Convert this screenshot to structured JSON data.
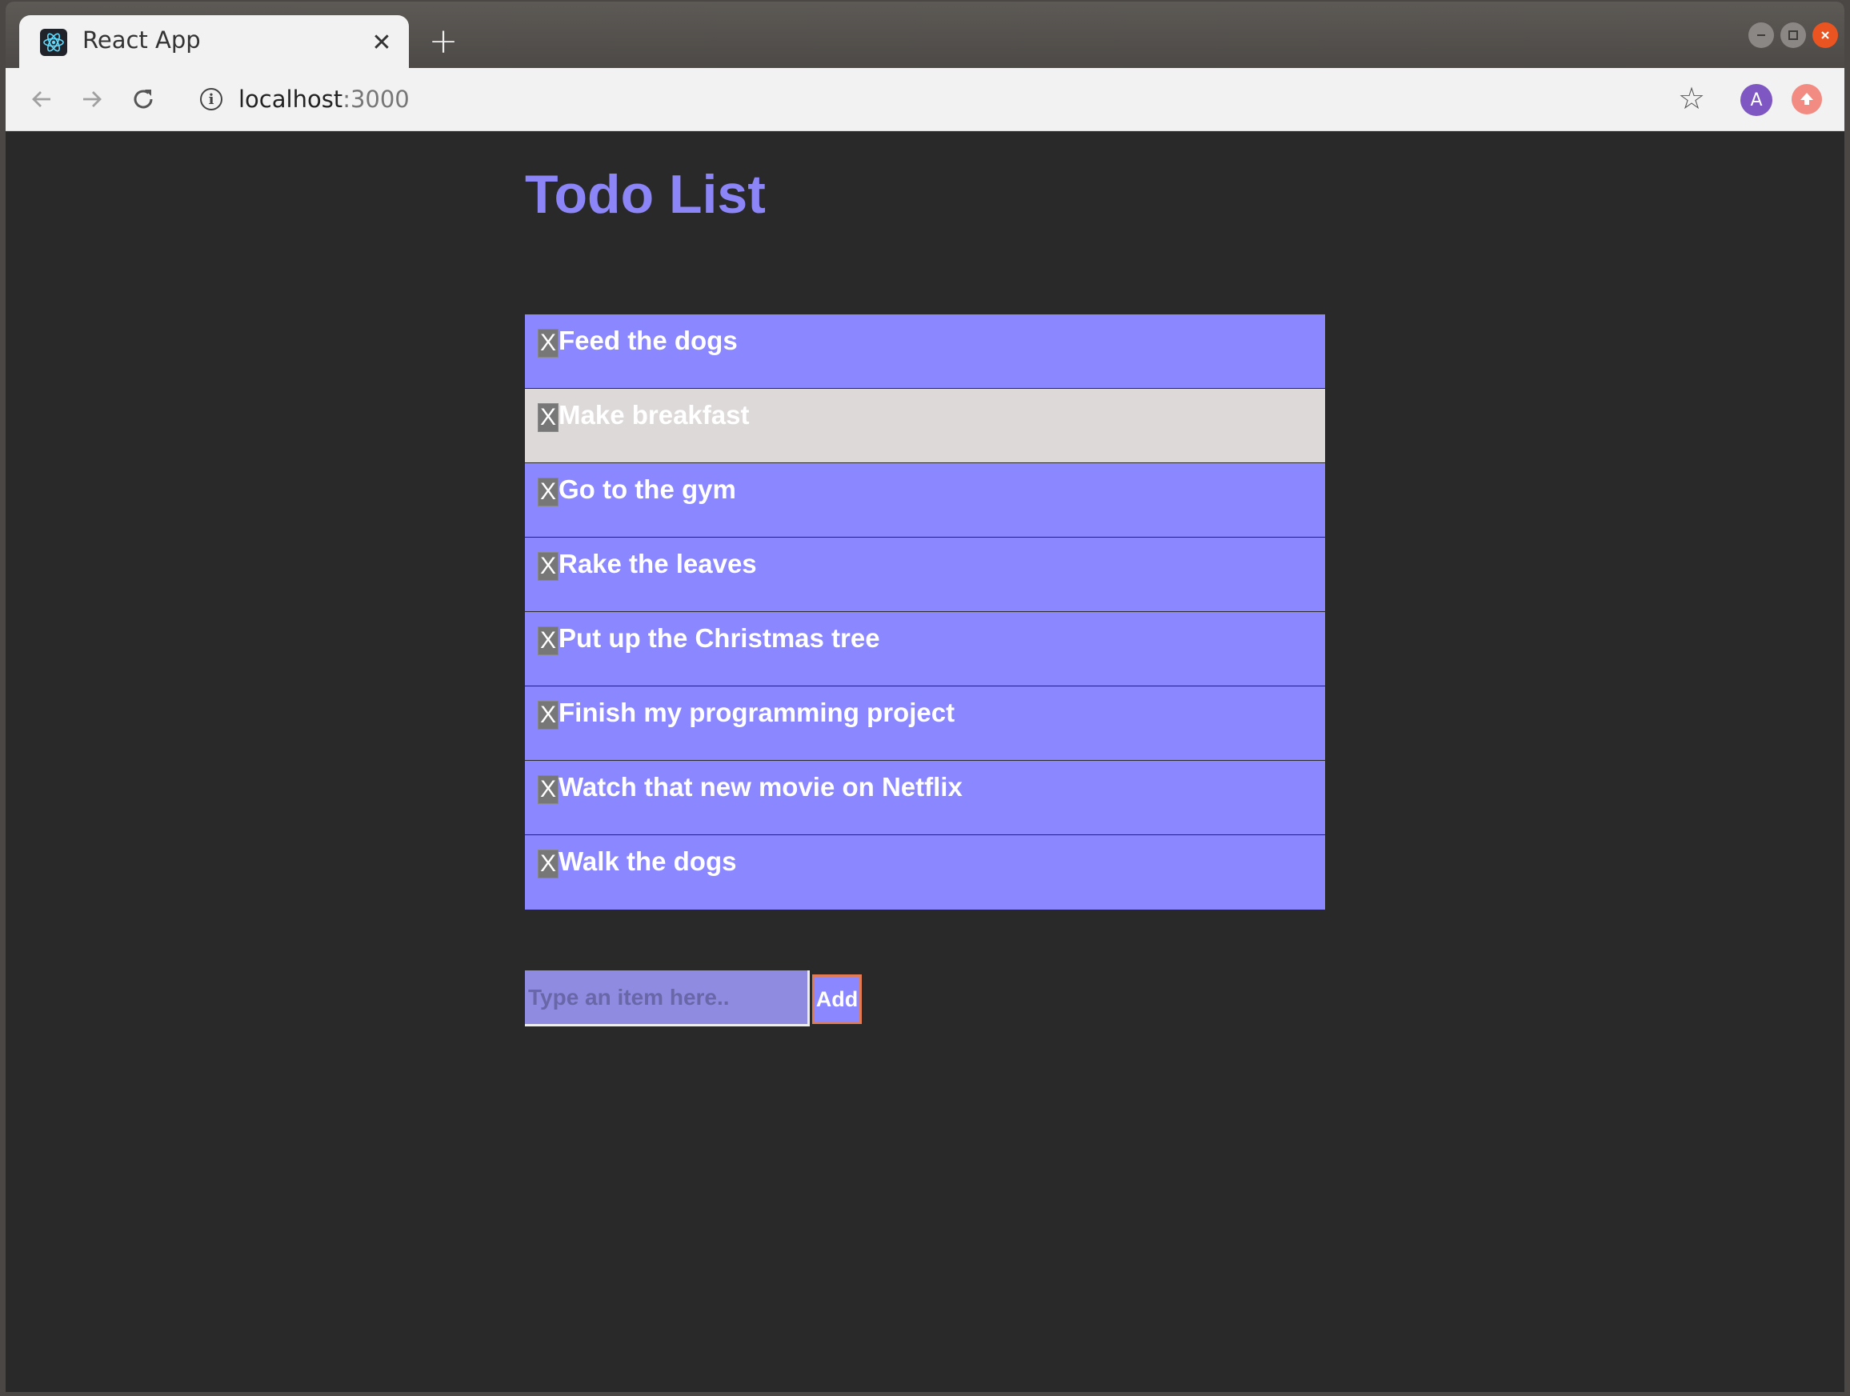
{
  "browser": {
    "tab_title": "React App",
    "tab_close": "✕",
    "new_tab": "+",
    "url_host": "localhost",
    "url_port": ":3000",
    "profile_initial": "A",
    "favicon": "react-atom-icon"
  },
  "page": {
    "title": "Todo List",
    "items": [
      {
        "remove": "X",
        "text": "Feed the dogs"
      },
      {
        "remove": "X",
        "text": "Make breakfast"
      },
      {
        "remove": "X",
        "text": "Go to the gym"
      },
      {
        "remove": "X",
        "text": "Rake the leaves"
      },
      {
        "remove": "X",
        "text": "Put up the Christmas tree"
      },
      {
        "remove": "X",
        "text": "Finish my programming project"
      },
      {
        "remove": "X",
        "text": "Watch that new movie on Netflix"
      },
      {
        "remove": "X",
        "text": "Walk the dogs"
      }
    ],
    "input_placeholder": "Type an item here..",
    "add_label": "Add"
  },
  "colors": {
    "item_bg": "#8b87ff",
    "item_hover_bg": "#dcd9d8",
    "title": "#8b85f8",
    "page_bg": "#292929",
    "add_border": "#e07b53"
  }
}
